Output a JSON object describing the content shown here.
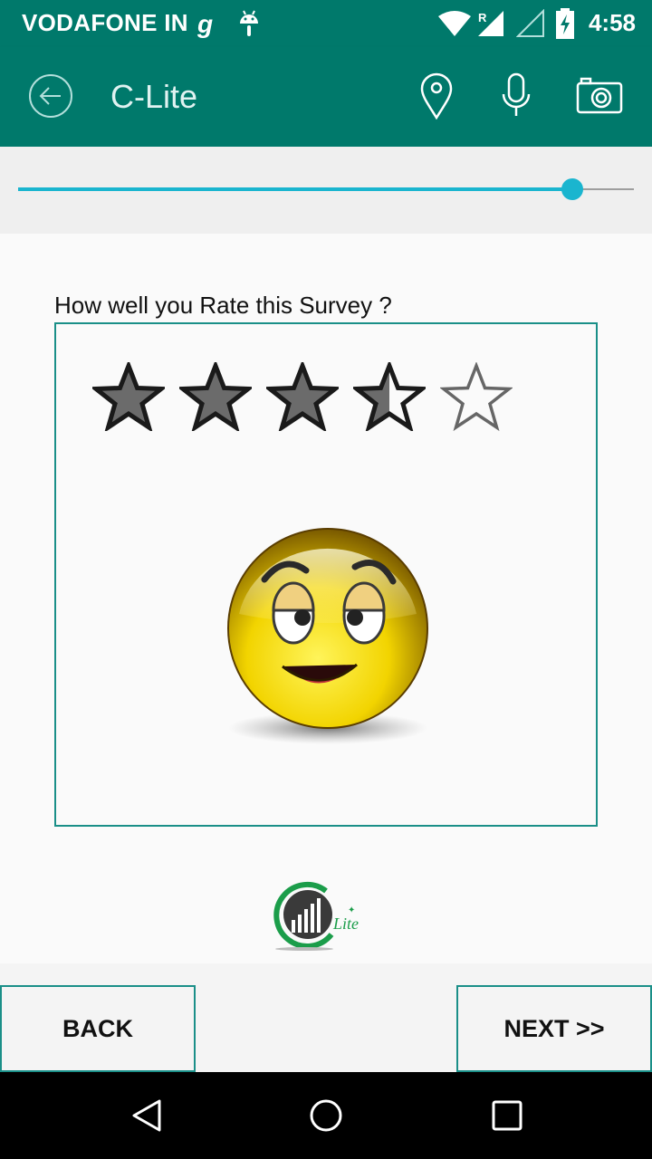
{
  "status_bar": {
    "carrier": "VODAFONE IN",
    "time": "4:58",
    "icons": [
      "g-network-icon",
      "android-icon",
      "wifi-icon",
      "signal-roaming-icon",
      "signal-empty-icon",
      "battery-charging-icon"
    ]
  },
  "app_bar": {
    "title": "C-Lite",
    "icons": [
      "back-arrow-icon",
      "location-pin-icon",
      "microphone-icon",
      "camera-icon"
    ]
  },
  "progress": {
    "fraction": 0.9,
    "color": "#1ab5cf"
  },
  "survey": {
    "question": "How well you Rate this Survey ?",
    "rating": 3.5,
    "max_rating": 5,
    "reaction": "smiley-face"
  },
  "brand": {
    "logo_text": "Lite"
  },
  "buttons": {
    "back": "BACK",
    "next": "NEXT >>"
  },
  "nav_bar": {
    "icons": [
      "back-triangle-icon",
      "home-circle-icon",
      "recents-square-icon"
    ]
  },
  "colors": {
    "primary": "#00796b",
    "accent": "#1a8f88",
    "star_fill": "#6b6b6b"
  }
}
